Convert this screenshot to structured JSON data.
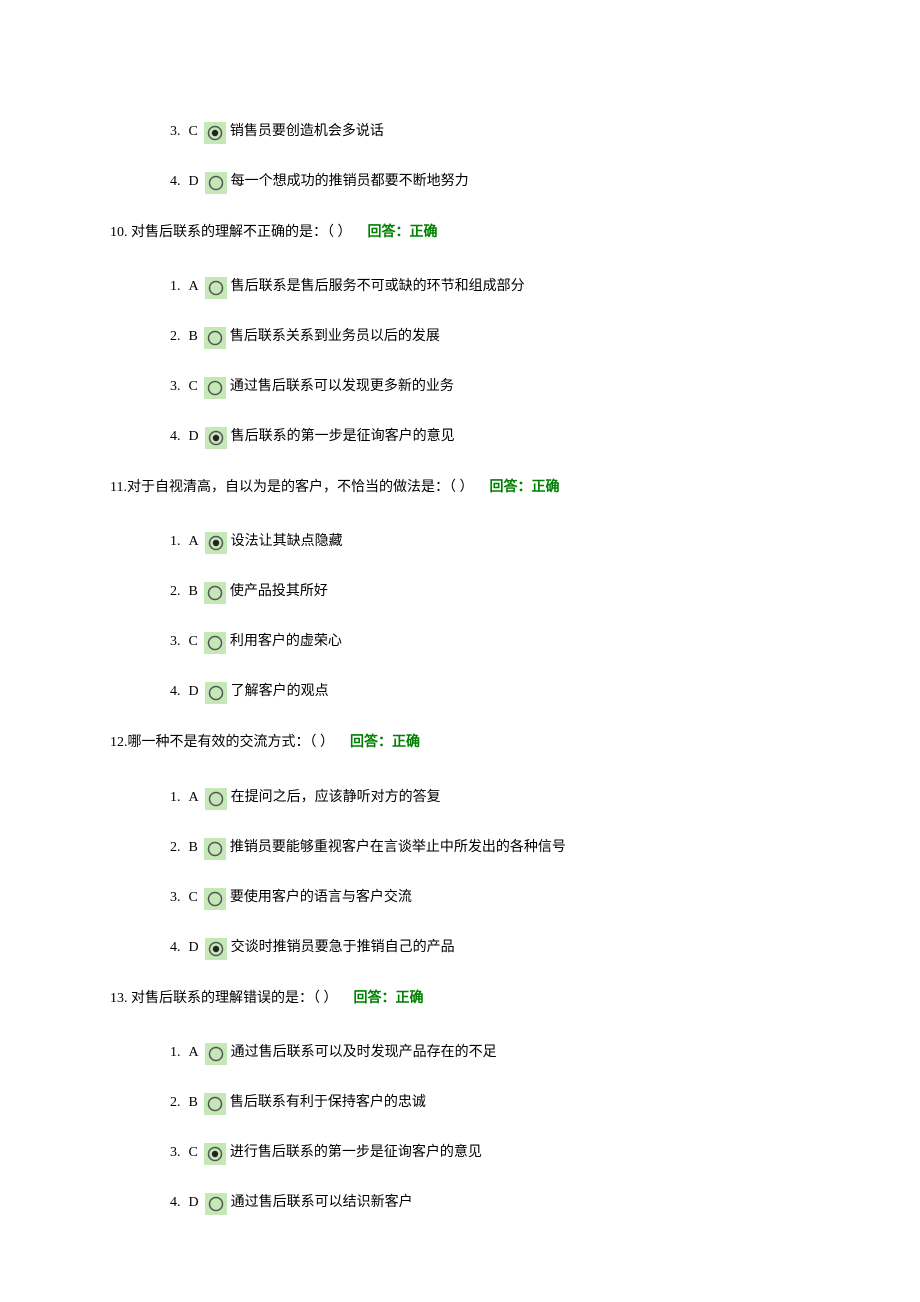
{
  "feedback_label": "回答：正确",
  "orphan_options": [
    {
      "num": "3.",
      "letter": "C",
      "selected": true,
      "text": "销售员要创造机会多说话"
    },
    {
      "num": "4.",
      "letter": "D",
      "selected": false,
      "text": "每一个想成功的推销员都要不断地努力"
    }
  ],
  "questions": [
    {
      "num": "10.",
      "text": "  对售后联系的理解不正确的是：（ ）",
      "feedback": true,
      "options": [
        {
          "num": "1.",
          "letter": "A",
          "selected": false,
          "text": "售后联系是售后服务不可或缺的环节和组成部分"
        },
        {
          "num": "2.",
          "letter": "B",
          "selected": false,
          "text": "售后联系关系到业务员以后的发展"
        },
        {
          "num": "3.",
          "letter": "C",
          "selected": false,
          "text": "通过售后联系可以发现更多新的业务"
        },
        {
          "num": "4.",
          "letter": "D",
          "selected": true,
          "text": "售后联系的第一步是征询客户的意见"
        }
      ]
    },
    {
      "num": "11.",
      "text": "对于自视清高，自以为是的客户，不恰当的做法是：（ ）",
      "feedback": true,
      "options": [
        {
          "num": "1.",
          "letter": "A",
          "selected": true,
          "text": "设法让其缺点隐藏"
        },
        {
          "num": "2.",
          "letter": "B",
          "selected": false,
          "text": "使产品投其所好"
        },
        {
          "num": "3.",
          "letter": "C",
          "selected": false,
          "text": "利用客户的虚荣心"
        },
        {
          "num": "4.",
          "letter": "D",
          "selected": false,
          "text": "了解客户的观点"
        }
      ]
    },
    {
      "num": "12.",
      "text": "哪一种不是有效的交流方式：（ ）",
      "feedback": true,
      "options": [
        {
          "num": "1.",
          "letter": "A",
          "selected": false,
          "text": "在提问之后，应该静听对方的答复"
        },
        {
          "num": "2.",
          "letter": "B",
          "selected": false,
          "text": "推销员要能够重视客户在言谈举止中所发出的各种信号"
        },
        {
          "num": "3.",
          "letter": "C",
          "selected": false,
          "text": "要使用客户的语言与客户交流"
        },
        {
          "num": "4.",
          "letter": "D",
          "selected": true,
          "text": "交谈时推销员要急于推销自己的产品"
        }
      ]
    },
    {
      "num": "13.",
      "text": "  对售后联系的理解错误的是：（ ）",
      "feedback": true,
      "options": [
        {
          "num": "1.",
          "letter": "A",
          "selected": false,
          "text": "通过售后联系可以及时发现产品存在的不足"
        },
        {
          "num": "2.",
          "letter": "B",
          "selected": false,
          "text": "售后联系有利于保持客户的忠诚"
        },
        {
          "num": "3.",
          "letter": "C",
          "selected": true,
          "text": "进行售后联系的第一步是征询客户的意见"
        },
        {
          "num": "4.",
          "letter": "D",
          "selected": false,
          "text": "通过售后联系可以结识新客户"
        }
      ]
    }
  ]
}
